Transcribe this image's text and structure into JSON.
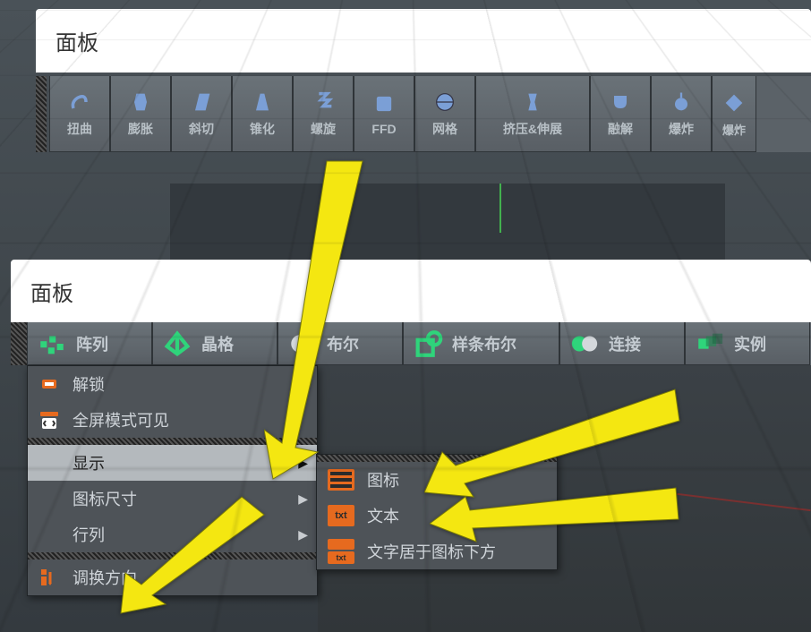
{
  "panel1": {
    "title": "面板"
  },
  "toolbar1": [
    {
      "label": "扭曲",
      "icon": "twist"
    },
    {
      "label": "膨胀",
      "icon": "bulge"
    },
    {
      "label": "斜切",
      "icon": "shear"
    },
    {
      "label": "锥化",
      "icon": "taper"
    },
    {
      "label": "螺旋",
      "icon": "spiral"
    },
    {
      "label": "FFD",
      "icon": "ffd"
    },
    {
      "label": "网格",
      "icon": "mesh"
    },
    {
      "label": "挤压&伸展",
      "icon": "squash",
      "wide": true
    },
    {
      "label": "融解",
      "icon": "melt"
    },
    {
      "label": "爆炸",
      "icon": "explode"
    },
    {
      "label": "爆炸",
      "icon": "explodefz"
    }
  ],
  "panel2": {
    "title": "面板"
  },
  "toolbar2": [
    {
      "label": "阵列",
      "icon": "array"
    },
    {
      "label": "晶格",
      "icon": "lattice"
    },
    {
      "label": "布尔",
      "icon": "boole"
    },
    {
      "label": "样条布尔",
      "icon": "splineboole"
    },
    {
      "label": "连接",
      "icon": "connect"
    },
    {
      "label": "实例",
      "icon": "instance"
    }
  ],
  "context_menu": [
    {
      "label": "解锁",
      "icon": "unlock"
    },
    {
      "label": "全屏模式可见",
      "icon": "fullscreen"
    },
    {
      "label": "显示",
      "icon": null,
      "submenu": true,
      "active": true
    },
    {
      "label": "图标尺寸",
      "icon": null,
      "submenu": true
    },
    {
      "label": "行列",
      "icon": null,
      "submenu": true
    },
    {
      "label": "调换方向",
      "icon": "transpose"
    }
  ],
  "submenu_display": [
    {
      "label": "图标",
      "icon": "bars"
    },
    {
      "label": "文本",
      "icon": "txt"
    },
    {
      "label": "文字居于图标下方",
      "icon": "combo"
    }
  ]
}
